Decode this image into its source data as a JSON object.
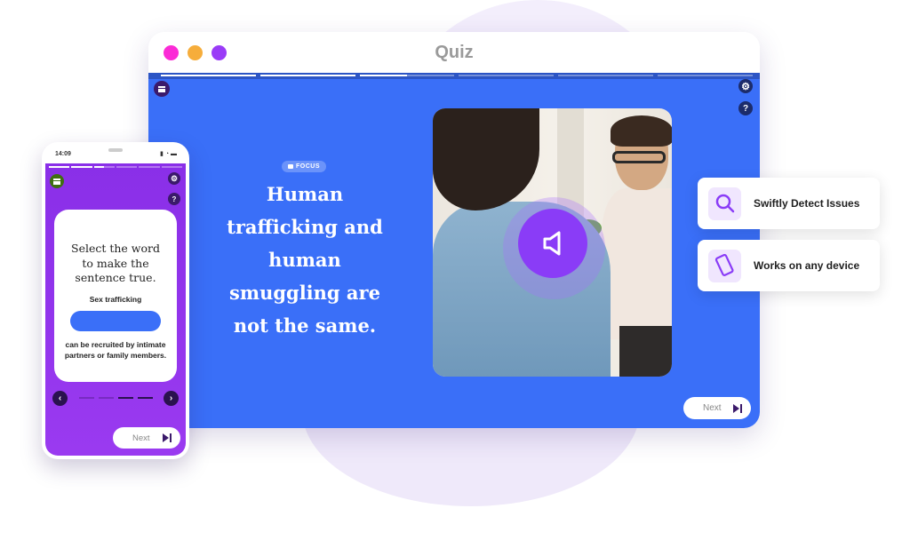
{
  "colors": {
    "traffic_red": "#fb2bd6",
    "traffic_yellow": "#f6ad3b",
    "traffic_purple": "#9a3cf7",
    "stage_blue": "#3a6ff8",
    "accent_purple": "#8a3cf7",
    "phone_purple": "#8a2fe8"
  },
  "window": {
    "title": "Quiz",
    "progress_segments": [
      1,
      1,
      0.5,
      0,
      0,
      0
    ],
    "focus_badge": "FOCUS",
    "headline": "Human trafficking and human smuggling are not the same.",
    "menu_icon": "menu-icon",
    "settings_icon": "gear-icon",
    "help_label": "?",
    "audio_icon": "speaker-icon",
    "next_label": "Next"
  },
  "features": [
    {
      "icon": "search-icon",
      "label": "Swiftly Detect Issues"
    },
    {
      "icon": "phone-icon",
      "label": "Works on any device"
    }
  ],
  "phone": {
    "time": "14:09",
    "status_icons": "▮ ◔ ▬",
    "progress_segments": [
      1,
      1,
      0.5,
      0,
      0,
      0
    ],
    "help_label": "?",
    "question": "Select the word to make the sentence true.",
    "sentence_start": "Sex trafficking",
    "sentence_end": "can be recruited by intimate partners or family members.",
    "prev_label": "‹",
    "next_arrow_label": "›",
    "pager_active": [
      false,
      false,
      true,
      true
    ],
    "next_label": "Next"
  }
}
